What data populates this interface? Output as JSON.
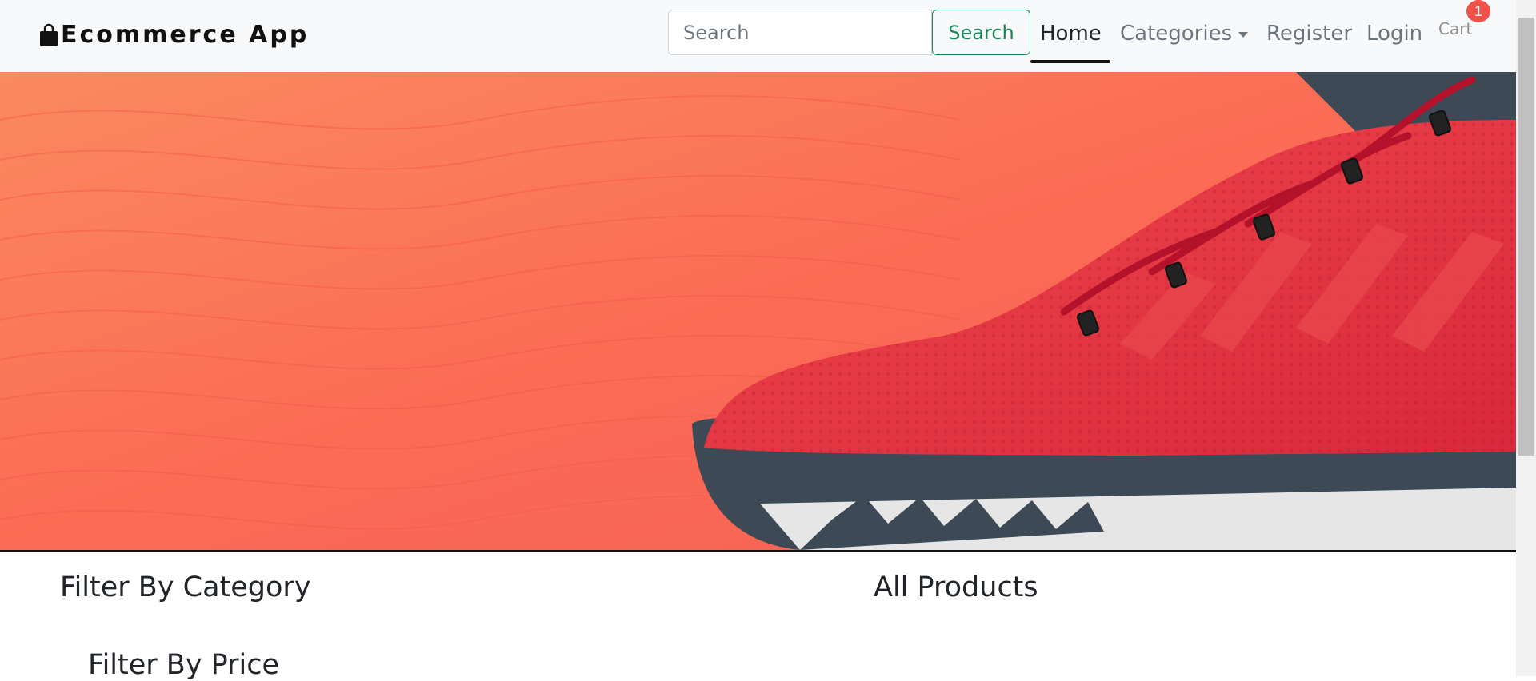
{
  "navbar": {
    "brand": "Ecommerce App",
    "brand_icon": "shopping-bag-icon",
    "search": {
      "placeholder": "Search",
      "value": "",
      "button_label": "Search"
    },
    "links": {
      "home": "Home",
      "categories": "Categories",
      "register": "Register",
      "login": "Login",
      "cart": "Cart"
    },
    "cart_count": "1",
    "accent_color": "#198754",
    "badge_color": "#f0524a"
  },
  "banner": {
    "image_subject": "red-sneaker-on-coral-background",
    "background_color": "#fb6b55"
  },
  "content": {
    "filter_category_heading": "Filter By Category",
    "all_products_heading": "All Products",
    "filter_price_heading": "Filter By Price"
  }
}
